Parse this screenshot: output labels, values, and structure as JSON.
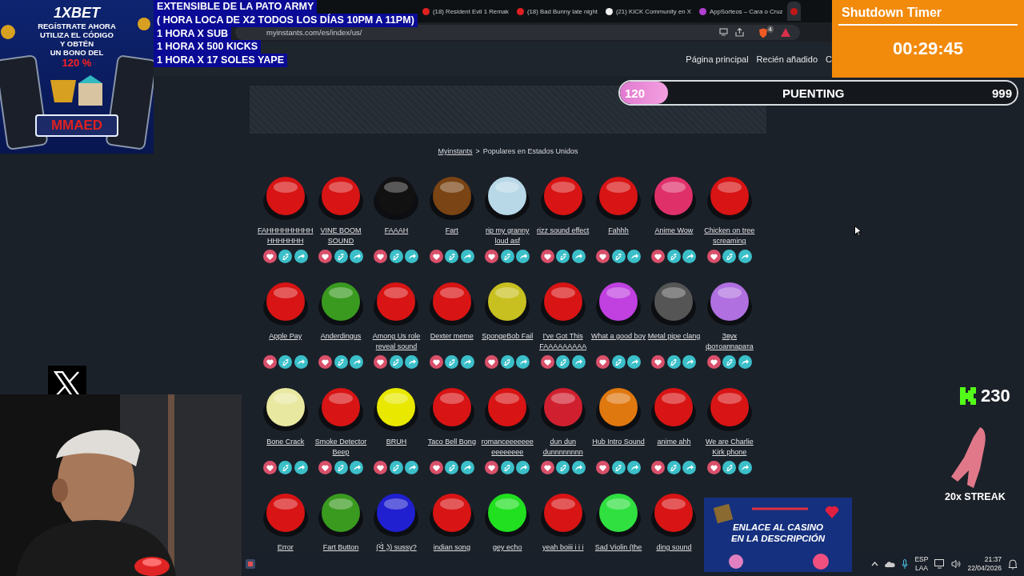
{
  "browser": {
    "tabs": [
      {
        "title": "(18) Resident Evil 1 Remak",
        "color": "#e02020",
        "selected": false
      },
      {
        "title": "(18) Bad Bunny late night",
        "color": "#e02020",
        "selected": false
      },
      {
        "title": "(21) KICK Community en X",
        "color": "#f0f0f0",
        "selected": false
      },
      {
        "title": "AppSorteos – Cara o Cruz",
        "color": "#b040d0",
        "selected": false
      },
      {
        "color": "#c01818",
        "selected": true
      }
    ],
    "address": "myinstants.com/es/index/us/",
    "shield_badge": "4"
  },
  "site": {
    "nav": [
      "Página principal",
      "Recién añadido",
      "C"
    ],
    "breadcrumb": {
      "link": "Myinstants",
      "separator": ">",
      "current": "Populares en Estados Unidos"
    },
    "sounds": [
      {
        "name": "FAHHHHHHHHHHHHHHHH",
        "color": "#d81414"
      },
      {
        "name": "VINE BOOM SOUND",
        "color": "#d81414"
      },
      {
        "name": "FAAAH",
        "color": "#111111"
      },
      {
        "name": "Fart",
        "color": "#7a4414"
      },
      {
        "name": "rip my granny loud asf",
        "color": "#b8d8e8"
      },
      {
        "name": "rizz sound effect",
        "color": "#d81414"
      },
      {
        "name": "Fahhh",
        "color": "#d81414"
      },
      {
        "name": "Anime Wow",
        "color": "#e0306a"
      },
      {
        "name": "Chicken on tree screaming",
        "color": "#d81414"
      },
      {
        "name": "Apple Pay",
        "color": "#d81414"
      },
      {
        "name": "Anderdingus",
        "color": "#3a9a20"
      },
      {
        "name": "Among Us role reveal sound",
        "color": "#d81414"
      },
      {
        "name": "Dexter meme",
        "color": "#d81414"
      },
      {
        "name": "SpongeBob Fail",
        "color": "#c8c020"
      },
      {
        "name": "I've Got This FAAAAAAAAA",
        "color": "#d81414"
      },
      {
        "name": "What a good boy",
        "color": "#c040e0"
      },
      {
        "name": "Metal pipe clang",
        "color": "#555555"
      },
      {
        "name": "Звук фотоаппарата",
        "color": "#b070e0"
      },
      {
        "name": "Bone Crack",
        "color": "#e8e8a0"
      },
      {
        "name": "Smoke Detector Beep",
        "color": "#d81414"
      },
      {
        "name": "BRUH",
        "color": "#e8e800"
      },
      {
        "name": "Taco Bell Bong",
        "color": "#d81414"
      },
      {
        "name": "romanceeeeeeeeeeeeeee",
        "color": "#d81414"
      },
      {
        "name": "dun dun dunnnnnnnn",
        "color": "#d02030"
      },
      {
        "name": "Hub Intro Sound",
        "color": "#e07810"
      },
      {
        "name": "anime ahh",
        "color": "#d81414"
      },
      {
        "name": "We are Charlie Kirk phone",
        "color": "#d81414"
      },
      {
        "name": "Error",
        "color": "#d81414"
      },
      {
        "name": "Fart Button",
        "color": "#3a9a20"
      },
      {
        "name": "(ᐛ ͜ʖ) sussy?",
        "color": "#2020d0"
      },
      {
        "name": "indian song",
        "color": "#d81414"
      },
      {
        "name": "gey echo",
        "color": "#20e020"
      },
      {
        "name": "yeah boiii i i i",
        "color": "#d81414"
      },
      {
        "name": "Sad Violin (the",
        "color": "#30e040"
      },
      {
        "name": "ding sound",
        "color": "#d81414"
      }
    ]
  },
  "overlays": {
    "promo_ad": {
      "logo": "1XBET",
      "lines": [
        "REGÍSTRATE AHORA",
        "UTILIZA EL CÓDIGO",
        "Y OBTÉN",
        "UN BONO DEL"
      ],
      "bonus": "120 %",
      "code": "MMAED"
    },
    "announcement": [
      "EXTENSIBLE  DE LA PATO ARMY",
      "( HORA LOCA DE X2 TODOS LOS DÍAS 10PM A 11PM)",
      "1 HORA X SUB",
      "1 HORA X 500 KICKS",
      "1 HORA X 17 SOLES YAPE"
    ],
    "timer": {
      "title": "Shutdown Timer",
      "time": "00:29:45"
    },
    "goal": {
      "current": "120",
      "label": "PUENTING",
      "target": "999",
      "level": 0.12
    },
    "kick": {
      "count": "230"
    },
    "streak": "20x STREAK",
    "casino_ad": "ENLACE AL CASINO\nEN LA DESCRIPCIÓN"
  },
  "taskbar": {
    "language": [
      "ESP",
      "LAA"
    ],
    "time": "21:37",
    "date": "22/04/2026"
  }
}
